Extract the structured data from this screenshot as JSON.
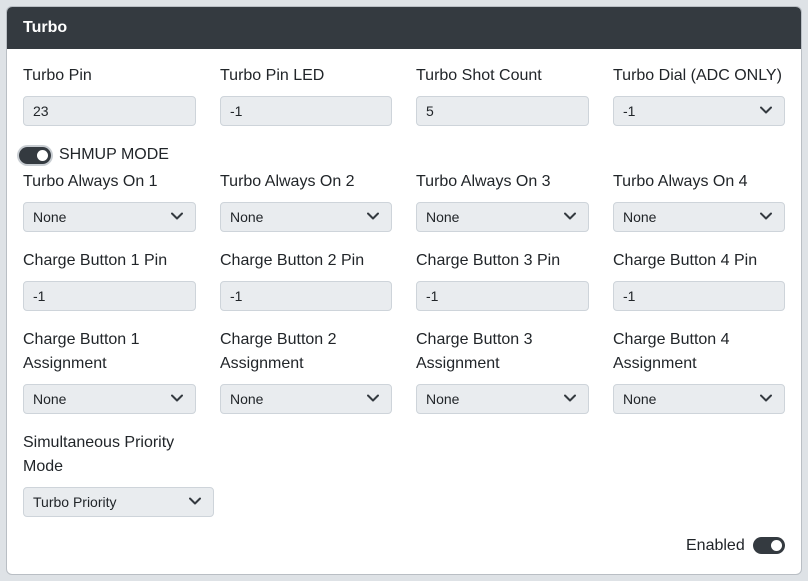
{
  "card": {
    "title": "Turbo",
    "row1": [
      {
        "label": "Turbo Pin",
        "value": "23",
        "type": "input"
      },
      {
        "label": "Turbo Pin LED",
        "value": "-1",
        "type": "input"
      },
      {
        "label": "Turbo Shot Count",
        "value": "5",
        "type": "input"
      },
      {
        "label": "Turbo Dial (ADC ONLY)",
        "value": "-1",
        "type": "select"
      }
    ],
    "shmup": {
      "label": "SHMUP MODE",
      "checked": true
    },
    "always_on": [
      {
        "label": "Turbo Always On 1",
        "value": "None"
      },
      {
        "label": "Turbo Always On 2",
        "value": "None"
      },
      {
        "label": "Turbo Always On 3",
        "value": "None"
      },
      {
        "label": "Turbo Always On 4",
        "value": "None"
      }
    ],
    "charge_pins": [
      {
        "label": "Charge Button 1 Pin",
        "value": "-1"
      },
      {
        "label": "Charge Button 2 Pin",
        "value": "-1"
      },
      {
        "label": "Charge Button 3 Pin",
        "value": "-1"
      },
      {
        "label": "Charge Button 4 Pin",
        "value": "-1"
      }
    ],
    "charge_assign": [
      {
        "label_line1": "Charge Button 1",
        "label_line2": "Assignment",
        "value": "None"
      },
      {
        "label_line1": "Charge Button 2",
        "label_line2": "Assignment",
        "value": "None"
      },
      {
        "label_line1": "Charge Button 3",
        "label_line2": "Assignment",
        "value": "None"
      },
      {
        "label_line1": "Charge Button 4",
        "label_line2": "Assignment",
        "value": "None"
      }
    ],
    "priority": {
      "label_line1": "Simultaneous Priority",
      "label_line2": "Mode",
      "value": "Turbo Priority"
    },
    "enabled": {
      "label": "Enabled",
      "checked": true
    }
  },
  "colors": {
    "header_bg": "#343a40",
    "input_bg": "#e9ecef",
    "switch_on": "#343a40"
  },
  "icons": {
    "select_arrow": "chevron-down-icon"
  }
}
